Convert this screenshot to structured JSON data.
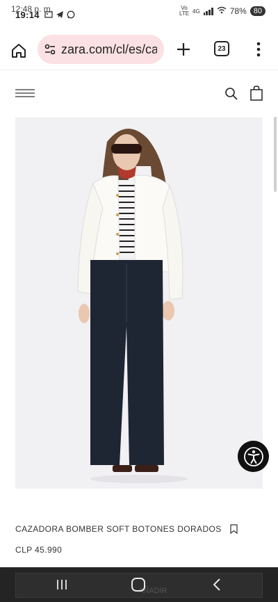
{
  "status_bar": {
    "time_previous": "12:48 p. m.",
    "time": "19:14",
    "network_top": "Vo",
    "network_bottom": "LTE",
    "network_gen": "4G",
    "battery_percent": "78%",
    "battery_badge": "80"
  },
  "browser": {
    "url": "zara.com/cl/es/ca",
    "tab_count": "23"
  },
  "product": {
    "name": "CAZADORA BOMBER SOFT BOTONES DORADOS",
    "price": "CLP 45.990"
  },
  "nav": {
    "ghost_label": "AÑADIR"
  },
  "colors": {
    "url_pill": "#fbe1e3",
    "image_bg": "#f1f0f3",
    "nav_bg": "#242424",
    "a11y_bg": "#111111"
  }
}
